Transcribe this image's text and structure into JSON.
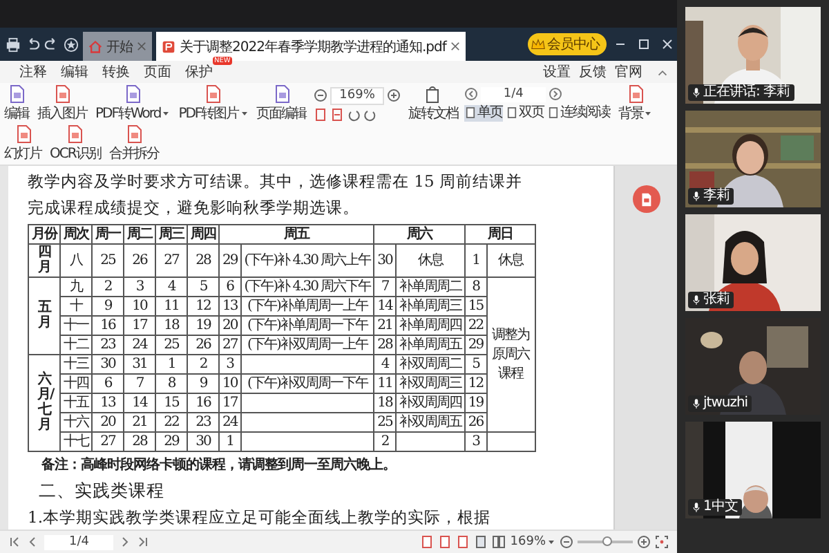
{
  "tabbar": {
    "tabs": [
      {
        "label": "开始",
        "kind": "home",
        "selected": false
      },
      {
        "label": "关于调整2022年春季学期教学进程的通知.pdf",
        "kind": "pdf",
        "selected": true
      }
    ],
    "member": "会员中心"
  },
  "menu": {
    "items": [
      {
        "label": "注释"
      },
      {
        "label": "编辑"
      },
      {
        "label": "转换"
      },
      {
        "label": "页面"
      },
      {
        "label": "保护",
        "badge": "NEW"
      }
    ],
    "right": [
      "设置",
      "反馈",
      "官网"
    ]
  },
  "toolbar": {
    "tools": [
      {
        "label": "编辑",
        "dropdown": false
      },
      {
        "label": "插入图片",
        "dropdown": false
      },
      {
        "label": "PDF转Word",
        "dropdown": true
      },
      {
        "label": "PDF转图片",
        "dropdown": true
      },
      {
        "label": "页面编辑",
        "dropdown": false
      }
    ],
    "zoom": "169%",
    "rotate": "旋转文档",
    "page": "1/4",
    "views": [
      {
        "label": "单页",
        "selected": true
      },
      {
        "label": "双页",
        "selected": false
      },
      {
        "label": "连续阅读",
        "selected": false
      }
    ],
    "tools_right": [
      {
        "label": "背景",
        "dropdown": true
      },
      {
        "label": "幻灯片",
        "dropdown": false
      },
      {
        "label": "OCR识别",
        "dropdown": false
      },
      {
        "label": "合并拆分",
        "dropdown": false
      }
    ]
  },
  "document": {
    "lines": [
      "教学内容及学时要求方可结课。其中，选修课程需在 15 周前结课并",
      "完成课程成绩提交，避免影响秋季学期选课。"
    ],
    "table": {
      "header": [
        {
          "label": "月份",
          "wide": false
        },
        {
          "label": "周次",
          "wide": false
        },
        {
          "label": "周一",
          "wide": false
        },
        {
          "label": "周二",
          "wide": false
        },
        {
          "label": "周三",
          "wide": false
        },
        {
          "label": "周四",
          "wide": false
        },
        {
          "label": "周五",
          "wide": true
        },
        {
          "label": "周六",
          "wide": true
        },
        {
          "label": "周日",
          "wide": true
        }
      ],
      "months": [
        {
          "label": "四月",
          "weeks": [
            {
              "week": "八",
              "days": [
                "25",
                "26",
                "27",
                "28"
              ],
              "fri": "29",
              "fri_note": "(下午)补 4.30 周六上午",
              "sat": "30",
              "sat_note": "休息",
              "sun": "1",
              "sun_note": "休息"
            }
          ]
        },
        {
          "label": "五月",
          "weeks": [
            {
              "week": "九",
              "days": [
                "2",
                "3",
                "4",
                "5"
              ],
              "fri": "6",
              "fri_note": "(下午)补 4.30 周六下午",
              "sat": "7",
              "sat_note": "补单周周二",
              "sun": "8",
              "sun_note": "调整为原周六课程"
            },
            {
              "week": "十",
              "days": [
                "9",
                "10",
                "11",
                "12"
              ],
              "fri": "13",
              "fri_note": "(下午)补单周周一上午",
              "sat": "14",
              "sat_note": "补单周周三",
              "sun": "15",
              "sun_note_continues": true
            },
            {
              "week": "十一",
              "days": [
                "16",
                "17",
                "18",
                "19"
              ],
              "fri": "20",
              "fri_note": "(下午)补单周周一下午",
              "sat": "21",
              "sat_note": "补单周周四",
              "sun": "22",
              "sun_note_continues": true
            },
            {
              "week": "十二",
              "days": [
                "23",
                "24",
                "25",
                "26"
              ],
              "fri": "27",
              "fri_note": "(下午)补双周周一上午",
              "sat": "28",
              "sat_note": "补单周周五",
              "sun": "29",
              "sun_note_continues": true
            }
          ]
        },
        {
          "label": "六月/七月",
          "weeks": [
            {
              "week": "十三",
              "days": [
                "30",
                "31",
                "1",
                "2"
              ],
              "fri": "3",
              "sat": "4",
              "sat_note": "补双周周二",
              "sun": "5",
              "sun_note_continues": true
            },
            {
              "week": "十四",
              "days": [
                "6",
                "7",
                "8",
                "9"
              ],
              "fri": "10",
              "fri_note": "(下午)补双周周一下午",
              "sat": "11",
              "sat_note": "补双周周三",
              "sun": "12",
              "sun_note_continues": true
            },
            {
              "week": "十五",
              "days": [
                "13",
                "14",
                "15",
                "16"
              ],
              "fri": "17",
              "sat": "18",
              "sat_note": "补双周周四",
              "sun": "19",
              "sun_note_continues": true
            },
            {
              "week": "十六",
              "days": [
                "20",
                "21",
                "22",
                "23"
              ],
              "fri": "24",
              "sat": "25",
              "sat_note": "补双周周五",
              "sun": "26",
              "sun_note_continues": true
            },
            {
              "week": "十七",
              "days": [
                "27",
                "28",
                "29",
                "30"
              ],
              "fri": "1",
              "sat": "2",
              "sun": "3"
            }
          ]
        }
      ]
    },
    "note": "备注：高峰时段网络卡顿的课程，请调整到周一至周六晚上。",
    "heading": "二、实践类课程",
    "last_line": "1.本学期实践教学类课程应立足可能全面线上教学的实际，根据"
  },
  "bottom_bar": {
    "page": "1/4",
    "zoom": "169%",
    "zoom_slider": {
      "level": 0.55
    }
  },
  "videos": [
    {
      "name": "正在讲话: 李莉"
    },
    {
      "name": "李莉"
    },
    {
      "name": "张莉"
    },
    {
      "name": "jtwuzhi"
    },
    {
      "name": "1中文"
    }
  ]
}
